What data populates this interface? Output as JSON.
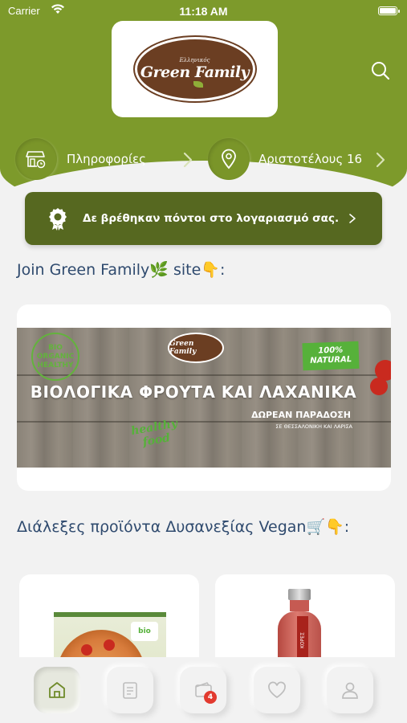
{
  "status_bar": {
    "carrier": "Carrier",
    "time": "11:18 AM"
  },
  "header": {
    "logo_small": "Ελληνικός",
    "logo_big": "Green Family",
    "search_icon": "search-icon"
  },
  "info_row": {
    "info_label": "Πληροφορίες",
    "info_icon": "store-icon",
    "address_label": "Αριστοτέλους 16",
    "address_icon": "location-pin-icon"
  },
  "points_banner": {
    "text": "Δε βρέθηκαν πόντοι στο λογαριασμό σας.",
    "icon": "award-badge-icon"
  },
  "join_section": {
    "title": "Join Green Family🌿 site👇:"
  },
  "promo": {
    "bio_stamp_line1": "BIO",
    "bio_stamp_line2": "ORGANIC",
    "bio_stamp_line3": "HEALTHY",
    "logo_text": "Green Family",
    "natural_line1": "100%",
    "natural_line2": "NATURAL",
    "headline": "ΒΙΟΛΟΓΙΚΑ ΦΡΟΥΤΑ ΚΑΙ ΛΑΧΑΝΙΚΑ",
    "delivery": "ΔΩΡΕΑΝ ΠΑΡΑΔΟΣΗ",
    "delivery_sub": "ΣΕ ΘΕΣΣΑΛΟΝΙΚΗ ΚΑΙ ΛΑΡΙΣΑ",
    "healthy_line1": "healthy",
    "healthy_line2": "food"
  },
  "products_section": {
    "title": "Διάλεξες προϊόντα Δυσανεξίας Vegan🛒👇:",
    "products": [
      {
        "tag": "bio"
      },
      {
        "label": "ΚΟΡΕΣ"
      }
    ]
  },
  "tabbar": {
    "tabs": [
      {
        "icon": "home-icon",
        "active": true
      },
      {
        "icon": "catalog-icon",
        "active": false
      },
      {
        "icon": "wallet-icon",
        "badge": "4",
        "active": false
      },
      {
        "icon": "heart-icon",
        "active": false
      },
      {
        "icon": "user-icon",
        "active": false
      }
    ]
  },
  "colors": {
    "brand_olive": "#7d9a2b",
    "banner_dark_olive": "#566820",
    "title_blue": "#2f4a6e",
    "logo_brown": "#6b3e22",
    "badge_red": "#e23a2f"
  }
}
